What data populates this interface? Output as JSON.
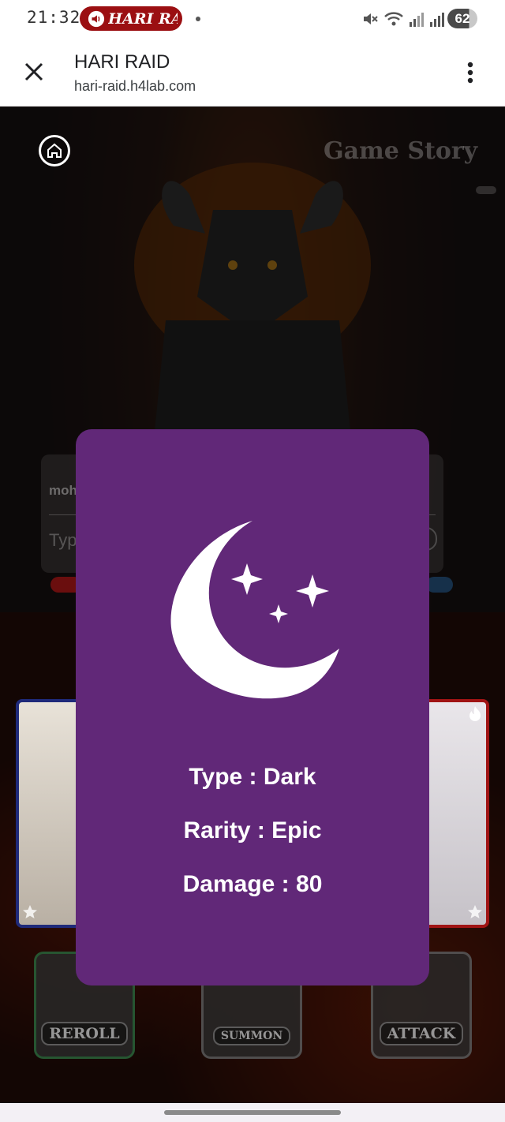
{
  "status_bar": {
    "time": "21:32",
    "media_pill": "HARI RAID",
    "battery": "62",
    "icons": [
      "mute-icon",
      "wifi-icon",
      "signal-icon",
      "signal-icon"
    ]
  },
  "browser": {
    "title": "HARI RAID",
    "url": "hari-raid.h4lab.com"
  },
  "game": {
    "story_label": "Game Story",
    "chat": {
      "name": "moh",
      "input_placeholder": "Typ"
    },
    "buttons": {
      "reroll": "REROLL",
      "summon": "SUMMON",
      "attack": "ATTACK"
    }
  },
  "modal": {
    "icon": "moon-stars-icon",
    "type": "Type : Dark",
    "rarity": "Rarity : Epic",
    "damage": "Damage : 80",
    "background": "#612878"
  }
}
